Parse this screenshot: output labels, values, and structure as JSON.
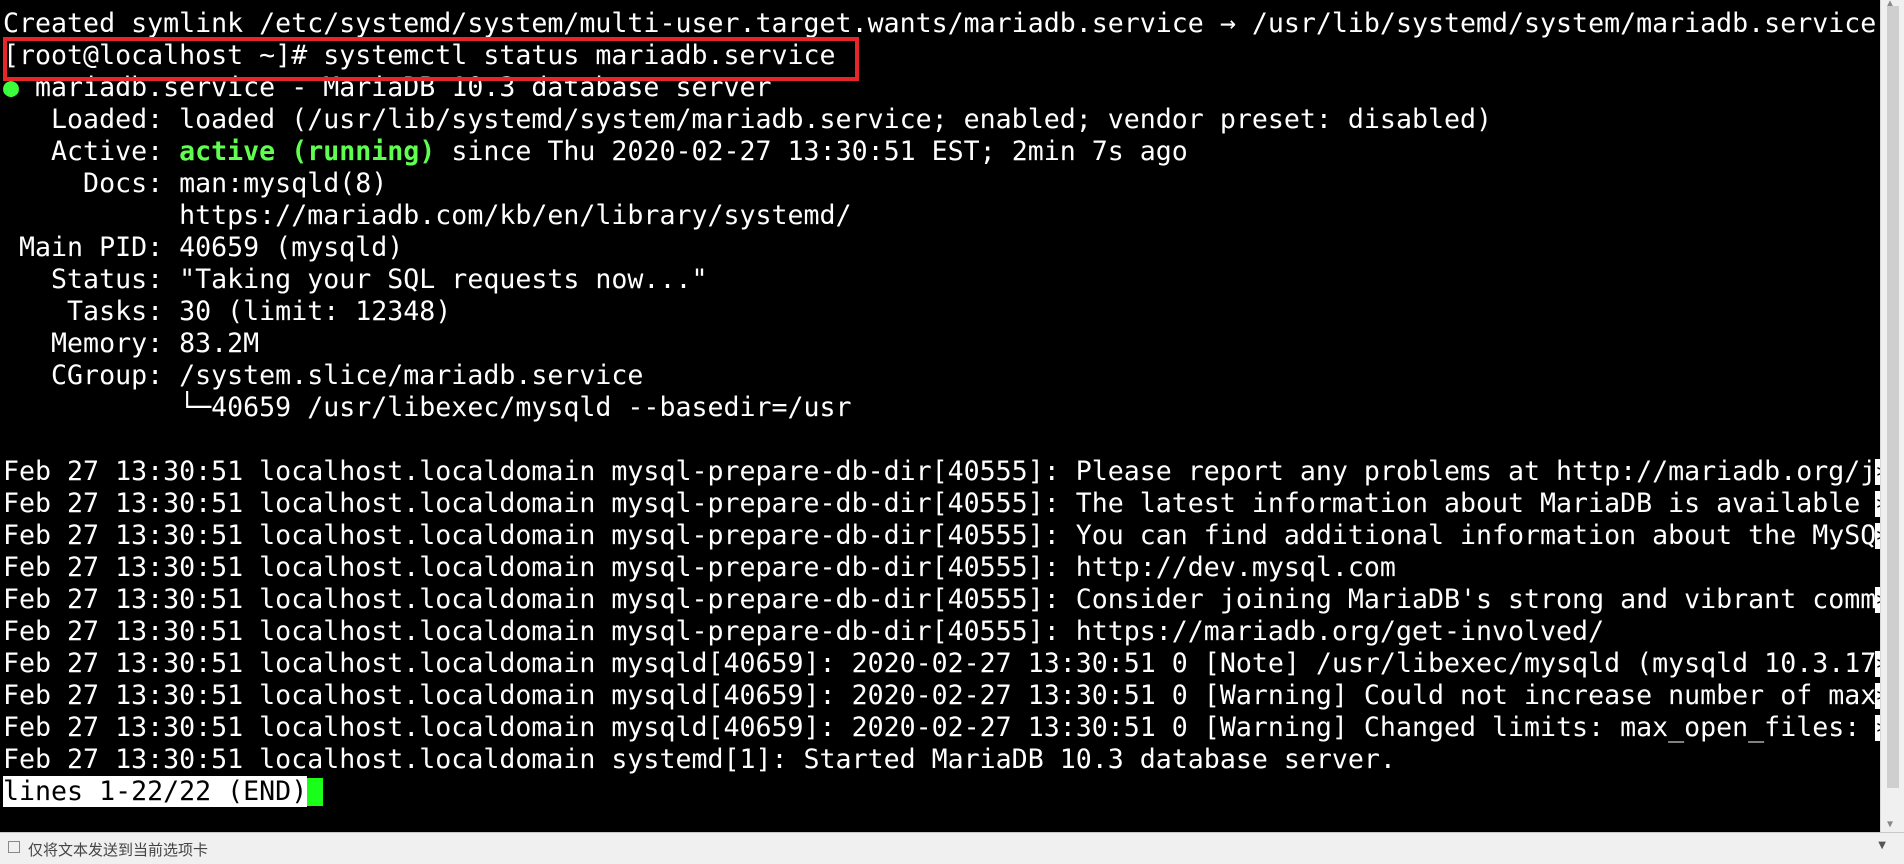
{
  "terminal": {
    "lines": [
      "Created symlink /etc/systemd/system/multi-user.target.wants/mariadb.service → /usr/lib/systemd/system/mariadb.service.",
      "[root@localhost ~]# systemctl status mariadb.service",
      "● mariadb.service - MariaDB 10.3 database server",
      "   Loaded: loaded (/usr/lib/systemd/system/mariadb.service; enabled; vendor preset: disabled)",
      "   Active: active (running) since Thu 2020-02-27 13:30:51 EST; 2min 7s ago",
      "     Docs: man:mysqld(8)",
      "           https://mariadb.com/kb/en/library/systemd/",
      " Main PID: 40659 (mysqld)",
      "   Status: \"Taking your SQL requests now...\"",
      "    Tasks: 30 (limit: 12348)",
      "   Memory: 83.2M",
      "   CGroup: /system.slice/mariadb.service",
      "           └─40659 /usr/libexec/mysqld --basedir=/usr",
      "",
      "Feb 27 13:30:51 localhost.localdomain mysql-prepare-db-dir[40555]: Please report any problems at http://mariadb.org/j",
      "Feb 27 13:30:51 localhost.localdomain mysql-prepare-db-dir[40555]: The latest information about MariaDB is available ",
      "Feb 27 13:30:51 localhost.localdomain mysql-prepare-db-dir[40555]: You can find additional information about the MySQ",
      "Feb 27 13:30:51 localhost.localdomain mysql-prepare-db-dir[40555]: http://dev.mysql.com",
      "Feb 27 13:30:51 localhost.localdomain mysql-prepare-db-dir[40555]: Consider joining MariaDB's strong and vibrant comm",
      "Feb 27 13:30:51 localhost.localdomain mysql-prepare-db-dir[40555]: https://mariadb.org/get-involved/",
      "Feb 27 13:30:51 localhost.localdomain mysqld[40659]: 2020-02-27 13:30:51 0 [Note] /usr/libexec/mysqld (mysqld 10.3.17",
      "Feb 27 13:30:51 localhost.localdomain mysqld[40659]: 2020-02-27 13:30:51 0 [Warning] Could not increase number of max",
      "Feb 27 13:30:51 localhost.localdomain mysqld[40659]: 2020-02-27 13:30:51 0 [Warning] Changed limits: max_open_files: ",
      "Feb 27 13:30:51 localhost.localdomain systemd[1]: Started MariaDB 10.3 database server.",
      "lines 1-22/22 (END)"
    ],
    "truncation_marker": ">",
    "active_state": "active (running)",
    "highlight_color": "#e8262a",
    "status_color": "#5fff4f"
  },
  "statusbar": {
    "text": "仅将文本发送到当前选项卡"
  },
  "icons": {
    "scroll_up": "triangle-up-icon",
    "scroll_down": "triangle-down-icon",
    "menu": "chevron-down-icon"
  }
}
